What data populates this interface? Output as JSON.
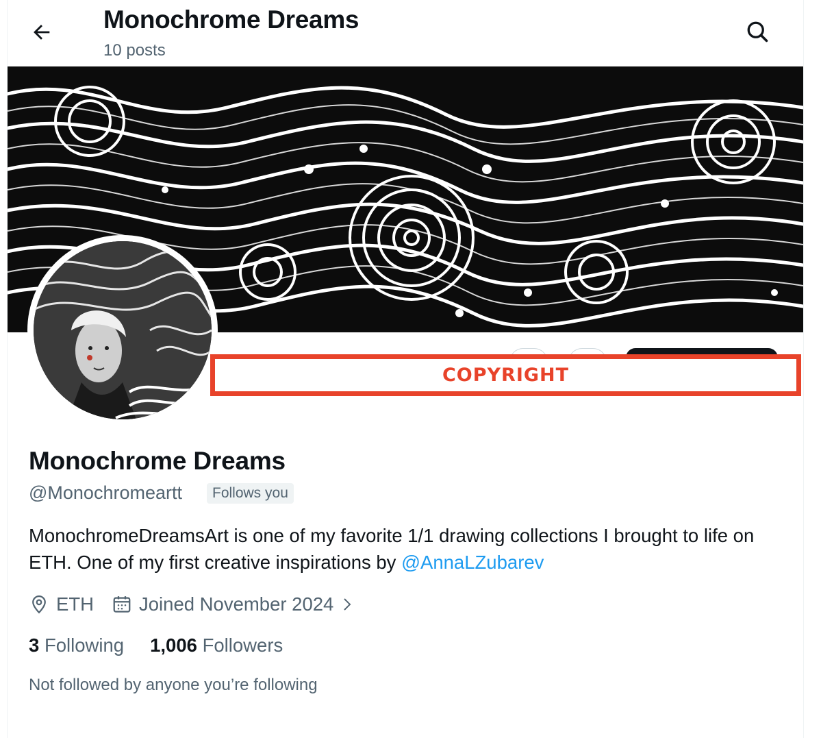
{
  "header": {
    "title": "Monochrome Dreams",
    "subtitle": "10 posts",
    "back_icon": "arrow-left-icon",
    "search_icon": "search-icon"
  },
  "overlay": {
    "label": "COPYRIGHT",
    "color": "#e8432a"
  },
  "profile": {
    "display_name": "Monochrome Dreams",
    "handle": "@Monochromeartt",
    "follows_you": "Follows you",
    "bio_text": "MonochromeDreamsArt is one of my favorite 1/1 drawing collections I brought to life on ETH. One of my first creative inspirations by ",
    "bio_mention": "@AnnaLZubarev",
    "location": "ETH",
    "joined": "Joined November 2024",
    "following_count": "3",
    "following_label": "Following",
    "followers_count": "1,006",
    "followers_label": "Followers",
    "not_followed": "Not followed by anyone you’re following"
  },
  "colors": {
    "text": "#0f1419",
    "secondary": "#536471",
    "link": "#1d9bf0",
    "badge_bg": "#eff3f4"
  }
}
